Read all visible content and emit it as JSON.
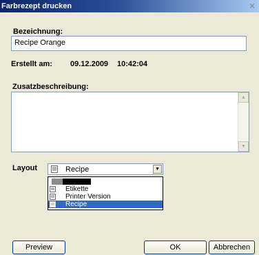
{
  "window": {
    "title": "Farbrezept drucken",
    "close_glyph": "✕"
  },
  "form": {
    "name_label": "Bezeichnung:",
    "name_value": "Recipe Orange",
    "created_label": "Erstellt am:",
    "created_date": "09.12.2009",
    "created_time": "10:42:04",
    "description_label": "Zusatzbeschreibung:",
    "description_value": ""
  },
  "layout": {
    "label": "Layout",
    "selected": "Recipe",
    "options": [
      {
        "label": "",
        "icon": "document-icon"
      },
      {
        "label": "Etikette",
        "icon": "document-icon"
      },
      {
        "label": "Printer Version",
        "icon": "document-icon"
      },
      {
        "label": "Recipe",
        "icon": "document-icon",
        "highlighted": true
      }
    ]
  },
  "buttons": {
    "preview": "Preview",
    "ok": "OK",
    "cancel": "Abbrechen"
  },
  "colors": {
    "title_bar_start": "#0a246a",
    "title_bar_end": "#a6caf0",
    "dialog_bg": "#ece9d8",
    "selection": "#316ac5"
  }
}
